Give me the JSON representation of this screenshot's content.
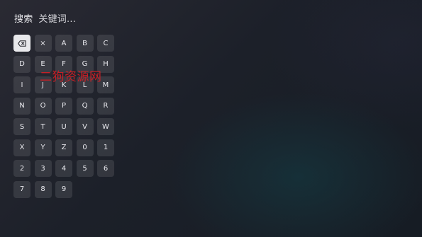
{
  "search": {
    "label": "搜索",
    "placeholder": "关键词..."
  },
  "keyboard": {
    "backspace_icon": "backspace-icon",
    "clear_label": "×",
    "keys": [
      "A",
      "B",
      "C",
      "D",
      "E",
      "F",
      "G",
      "H",
      "I",
      "J",
      "K",
      "L",
      "M",
      "N",
      "O",
      "P",
      "Q",
      "R",
      "S",
      "T",
      "U",
      "V",
      "W",
      "X",
      "Y",
      "Z",
      "0",
      "1",
      "2",
      "3",
      "4",
      "5",
      "6",
      "7",
      "8",
      "9"
    ]
  },
  "watermark": {
    "text": "二狗资源网"
  },
  "colors": {
    "active_key_bg": "#e9e9ec",
    "key_bg": "rgba(255,255,255,0.10)",
    "watermark": "#d21f25"
  }
}
